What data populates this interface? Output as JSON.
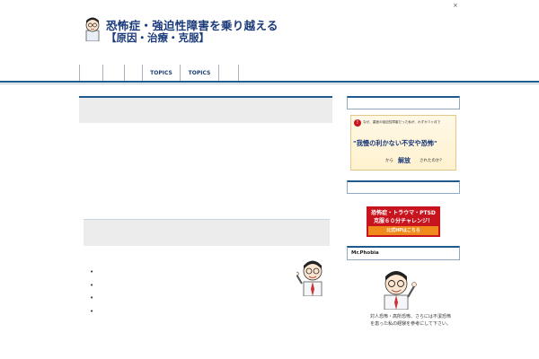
{
  "header": {
    "title_line1": "恐怖症・強迫性障害を乗り越える",
    "title_line2": "【原因・治療・克服】",
    "close_label": "×"
  },
  "nav": {
    "items": [
      {
        "label": ""
      },
      {
        "label": ""
      },
      {
        "label": ""
      },
      {
        "label": "TOPICS"
      },
      {
        "label": "TOPICS"
      },
      {
        "label": ""
      }
    ]
  },
  "main": {
    "bullets": [
      "•",
      "•",
      "•",
      "•"
    ]
  },
  "sidebar": {
    "banner1": {
      "top_text": "なぜ、重度の強迫性障害だった私が、わずか３ヶ月で",
      "main_text": "\"我慢の利かない不安や恐怖\"",
      "from_text": "から",
      "release_text": "解放",
      "end_text": "されたのか？"
    },
    "banner2": {
      "line1": "恐怖症・トラウマ・PTSD",
      "line2": "克服６０分チャレンジ！",
      "button": "公式HPはこちら"
    },
    "profile_title": "Mr.Phobia",
    "profile_text": "対人恐怖・高所恐怖、さらには不潔恐怖を患った私の経験を参考にして下さい。"
  },
  "colors": {
    "brand": "#1a3a7a",
    "accent": "#1f5a8e",
    "banner_red": "#c8141e",
    "banner_orange": "#f08a1c"
  }
}
